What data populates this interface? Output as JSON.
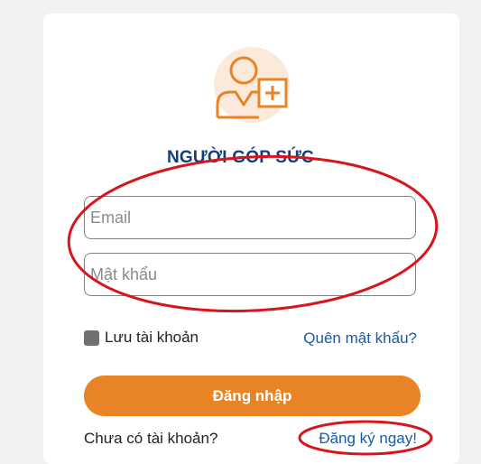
{
  "header": {
    "title": "NGƯỜI GÓP SỨC"
  },
  "form": {
    "email_placeholder": "Email",
    "email_value": "",
    "password_placeholder": "Mật khẩu",
    "password_value": "",
    "remember_label": "Lưu tài khoản",
    "remember_checked": true,
    "forgot_link": "Quên mật khẩu?",
    "login_button": "Đăng nhập"
  },
  "footer": {
    "no_account_text": "Chưa có tài khoản?",
    "register_link": "Đăng ký ngay!"
  },
  "colors": {
    "page_background": "#f2f2f2",
    "card_background": "#ffffff",
    "title_color": "#0f3f82",
    "link_color": "#1a5aa8",
    "accent": "#e98426",
    "logo_circle": "#fbe9da",
    "annotation_red": "#d8141c"
  },
  "icons": {
    "logo": "user-add-icon",
    "checkbox": "checkbox-icon"
  }
}
